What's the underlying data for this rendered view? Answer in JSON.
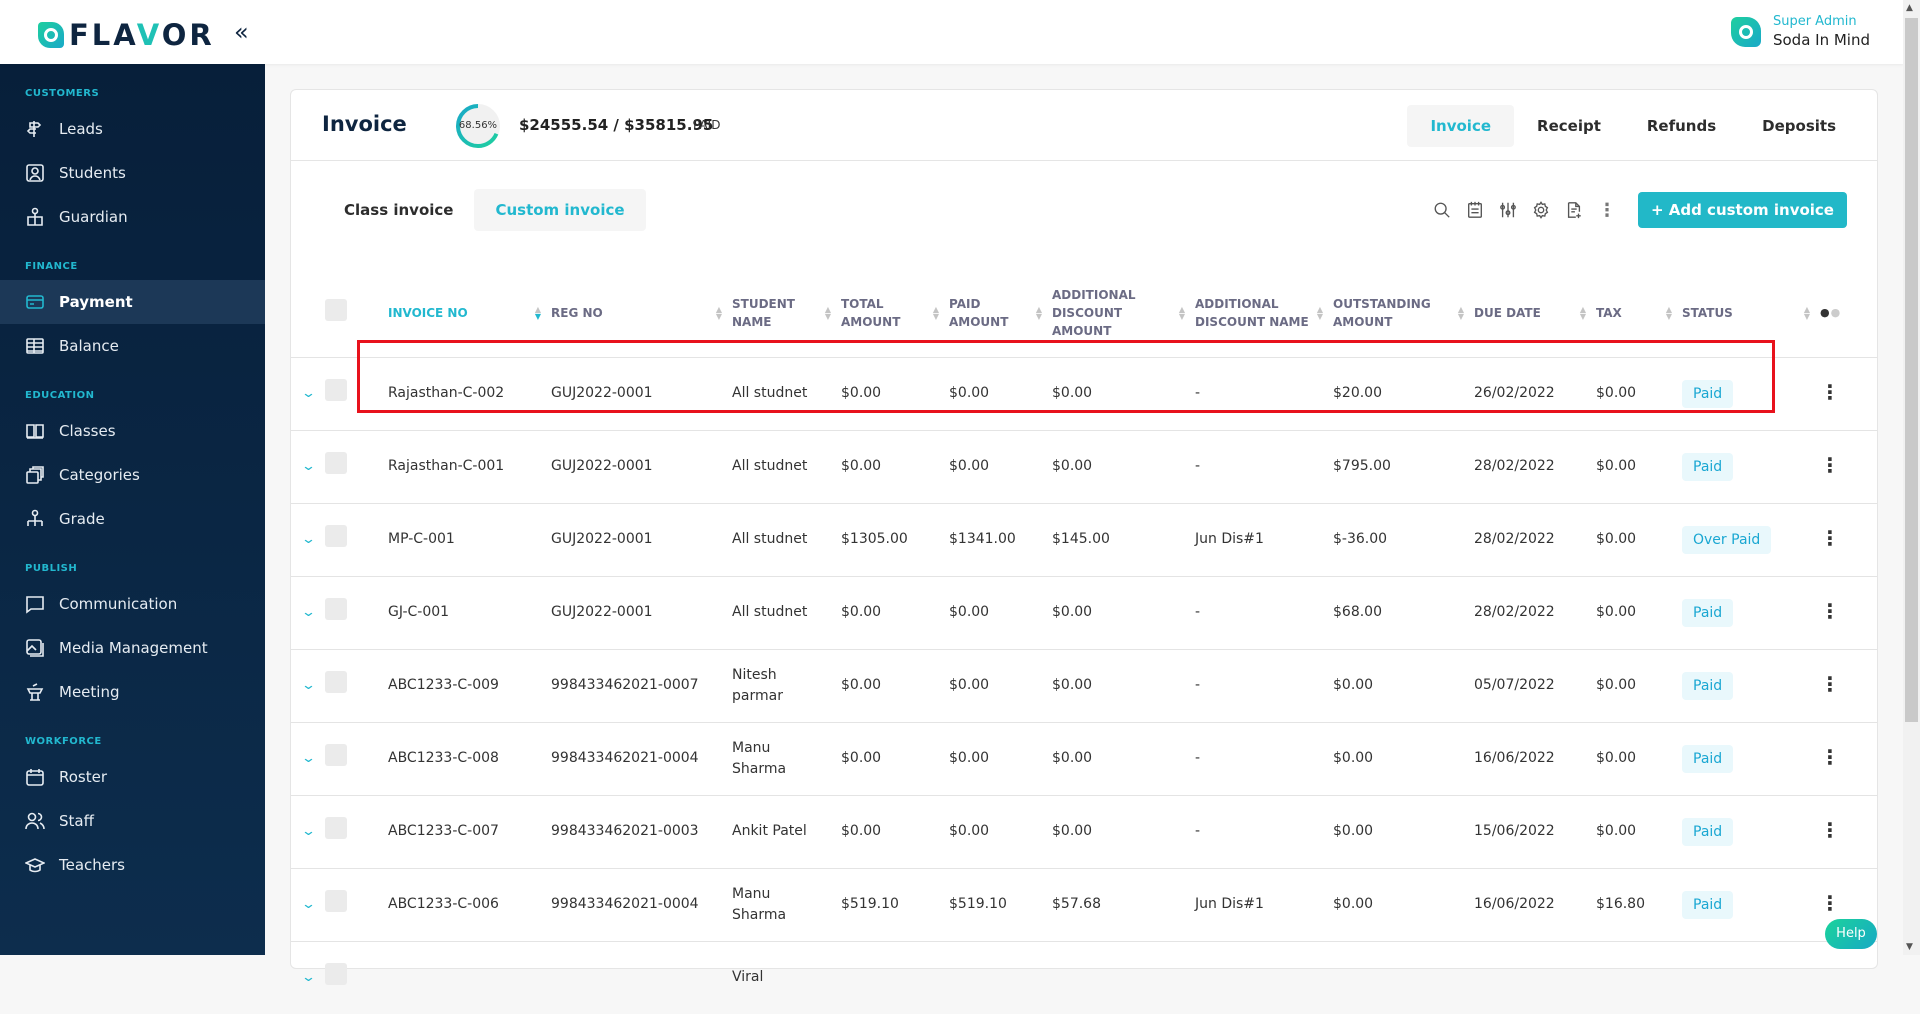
{
  "app": {
    "brand": "FLAVOR",
    "collapse_icon": "double-chevron-left-icon"
  },
  "user": {
    "role": "Super Admin",
    "name": "Soda In Mind"
  },
  "sidebar": {
    "sections": [
      {
        "title": "CUSTOMERS",
        "items": [
          {
            "label": "Leads",
            "icon": "signpost-icon"
          },
          {
            "label": "Students",
            "icon": "id-badge-icon"
          },
          {
            "label": "Guardian",
            "icon": "guardian-icon"
          }
        ]
      },
      {
        "title": "FINANCE",
        "items": [
          {
            "label": "Payment",
            "icon": "credit-card-icon",
            "active": true
          },
          {
            "label": "Balance",
            "icon": "ledger-icon"
          }
        ]
      },
      {
        "title": "EDUCATION",
        "items": [
          {
            "label": "Classes",
            "icon": "book-icon"
          },
          {
            "label": "Categories",
            "icon": "stack-icon"
          },
          {
            "label": "Grade",
            "icon": "hierarchy-icon"
          }
        ]
      },
      {
        "title": "PUBLISH",
        "items": [
          {
            "label": "Communication",
            "icon": "chat-icon"
          },
          {
            "label": "Media Management",
            "icon": "image-icon"
          },
          {
            "label": "Meeting",
            "icon": "podium-icon"
          }
        ]
      },
      {
        "title": "WORKFORCE",
        "items": [
          {
            "label": "Roster",
            "icon": "calendar-icon"
          },
          {
            "label": "Staff",
            "icon": "users-icon"
          },
          {
            "label": "Teachers",
            "icon": "graduation-cap-icon"
          }
        ]
      }
    ]
  },
  "invoice_header": {
    "title": "Invoice",
    "progress_percent": 68.56,
    "progress_label": "68.56%",
    "amounts": "$24555.54 / $35815.95",
    "paid_label": "PAID"
  },
  "tabs": [
    {
      "label": "Invoice",
      "active": true
    },
    {
      "label": "Receipt"
    },
    {
      "label": "Refunds"
    },
    {
      "label": "Deposits"
    }
  ],
  "subtabs": [
    {
      "label": "Class invoice"
    },
    {
      "label": "Custom invoice",
      "active": true
    }
  ],
  "toolbar": {
    "icons": [
      "search-icon",
      "notepad-icon",
      "filter-sliders-icon",
      "settings-icon",
      "export-document-icon",
      "more-vertical-icon"
    ],
    "add_button": "+ Add custom invoice"
  },
  "table": {
    "columns": [
      {
        "key": "invoice_no",
        "label": "INVOICE NO",
        "sorted": true
      },
      {
        "key": "reg_no",
        "label": "REG NO"
      },
      {
        "key": "student_name",
        "label": "STUDENT NAME"
      },
      {
        "key": "total_amount",
        "label": "TOTAL AMOUNT"
      },
      {
        "key": "paid_amount",
        "label": "PAID AMOUNT"
      },
      {
        "key": "add_discount_amount",
        "label": "ADDITIONAL DISCOUNT AMOUNT"
      },
      {
        "key": "add_discount_name",
        "label": "ADDITIONAL DISCOUNT NAME"
      },
      {
        "key": "outstanding_amount",
        "label": "OUTSTANDING AMOUNT"
      },
      {
        "key": "due_date",
        "label": "DUE DATE"
      },
      {
        "key": "tax",
        "label": "TAX"
      },
      {
        "key": "status",
        "label": "STATUS"
      }
    ],
    "rows": [
      {
        "invoice_no": "Rajasthan-C-002",
        "reg_no": "GUJ2022-0001",
        "student_name": "All studnet",
        "total_amount": "$0.00",
        "paid_amount": "$0.00",
        "add_discount_amount": "$0.00",
        "add_discount_name": "-",
        "outstanding_amount": "$20.00",
        "due_date": "26/02/2022",
        "tax": "$0.00",
        "status": "Paid",
        "highlighted": true
      },
      {
        "invoice_no": "Rajasthan-C-001",
        "reg_no": "GUJ2022-0001",
        "student_name": "All studnet",
        "total_amount": "$0.00",
        "paid_amount": "$0.00",
        "add_discount_amount": "$0.00",
        "add_discount_name": "-",
        "outstanding_amount": "$795.00",
        "due_date": "28/02/2022",
        "tax": "$0.00",
        "status": "Paid"
      },
      {
        "invoice_no": "MP-C-001",
        "reg_no": "GUJ2022-0001",
        "student_name": "All studnet",
        "total_amount": "$1305.00",
        "paid_amount": "$1341.00",
        "add_discount_amount": "$145.00",
        "add_discount_name": "Jun Dis#1",
        "outstanding_amount": "$-36.00",
        "due_date": "28/02/2022",
        "tax": "$0.00",
        "status": "Over Paid"
      },
      {
        "invoice_no": "GJ-C-001",
        "reg_no": "GUJ2022-0001",
        "student_name": "All studnet",
        "total_amount": "$0.00",
        "paid_amount": "$0.00",
        "add_discount_amount": "$0.00",
        "add_discount_name": "-",
        "outstanding_amount": "$68.00",
        "due_date": "28/02/2022",
        "tax": "$0.00",
        "status": "Paid"
      },
      {
        "invoice_no": "ABC1233-C-009",
        "reg_no": "998433462021-0007",
        "student_name": "Nitesh parmar",
        "total_amount": "$0.00",
        "paid_amount": "$0.00",
        "add_discount_amount": "$0.00",
        "add_discount_name": "-",
        "outstanding_amount": "$0.00",
        "due_date": "05/07/2022",
        "tax": "$0.00",
        "status": "Paid"
      },
      {
        "invoice_no": "ABC1233-C-008",
        "reg_no": "998433462021-0004",
        "student_name": "Manu Sharma",
        "total_amount": "$0.00",
        "paid_amount": "$0.00",
        "add_discount_amount": "$0.00",
        "add_discount_name": "-",
        "outstanding_amount": "$0.00",
        "due_date": "16/06/2022",
        "tax": "$0.00",
        "status": "Paid"
      },
      {
        "invoice_no": "ABC1233-C-007",
        "reg_no": "998433462021-0003",
        "student_name": "Ankit Patel",
        "total_amount": "$0.00",
        "paid_amount": "$0.00",
        "add_discount_amount": "$0.00",
        "add_discount_name": "-",
        "outstanding_amount": "$0.00",
        "due_date": "15/06/2022",
        "tax": "$0.00",
        "status": "Paid"
      },
      {
        "invoice_no": "ABC1233-C-006",
        "reg_no": "998433462021-0004",
        "student_name": "Manu Sharma",
        "total_amount": "$519.10",
        "paid_amount": "$519.10",
        "add_discount_amount": "$57.68",
        "add_discount_name": "Jun Dis#1",
        "outstanding_amount": "$0.00",
        "due_date": "16/06/2022",
        "tax": "$16.80",
        "status": "Paid"
      },
      {
        "invoice_no": "",
        "reg_no": "",
        "student_name": "Viral",
        "total_amount": "",
        "paid_amount": "",
        "add_discount_amount": "",
        "add_discount_name": "",
        "outstanding_amount": "",
        "due_date": "",
        "tax": "",
        "status": "",
        "partial": true
      }
    ]
  },
  "help_label": "Help",
  "colors": {
    "accent": "#22b8cf",
    "sidebar_bg": "#071f3a",
    "highlight": "#e8121c",
    "badge_bg": "#e9f8fc"
  }
}
